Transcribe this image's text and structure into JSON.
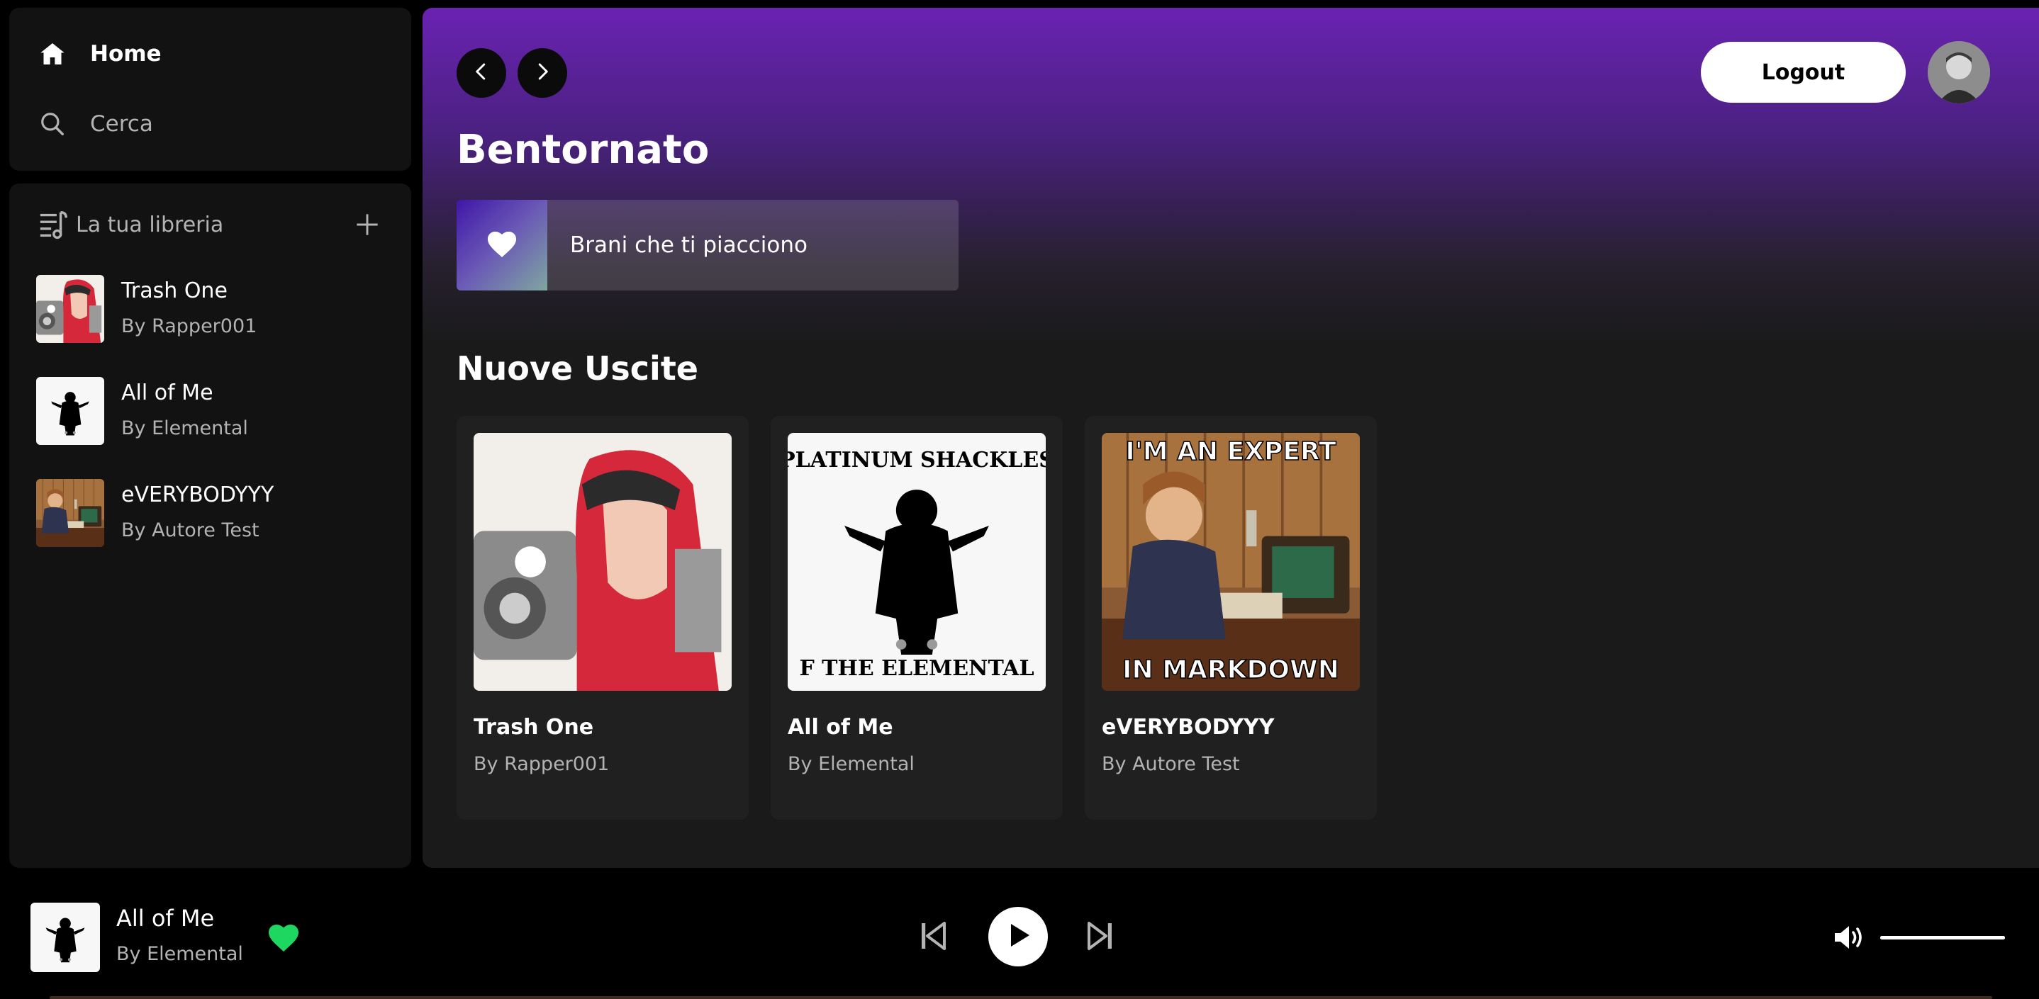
{
  "sidebar": {
    "nav": {
      "home_label": "Home",
      "search_label": "Cerca"
    },
    "library": {
      "title": "La tua libreria",
      "items": [
        {
          "title": "Trash One",
          "artist": "By Rapper001"
        },
        {
          "title": "All of Me",
          "artist": "By Elemental"
        },
        {
          "title": "eVERYBODYYY",
          "artist": "By Autore Test"
        }
      ]
    }
  },
  "header": {
    "logout_label": "Logout"
  },
  "main": {
    "greeting": "Bentornato",
    "liked_songs_label": "Brani che ti piacciono",
    "new_releases_title": "Nuove Uscite",
    "cards": [
      {
        "title": "Trash One",
        "artist": "By Rapper001"
      },
      {
        "title": "All of Me",
        "artist": "By Elemental"
      },
      {
        "title": "eVERYBODYYY",
        "artist": "By Autore Test"
      }
    ]
  },
  "artwork_text": {
    "platinum_top": "PLATINUM SHACKLES",
    "platinum_bottom": "F THE ELEMENTAL",
    "meme_top": "I'M AN EXPERT",
    "meme_bottom": "IN MARKDOWN"
  },
  "player": {
    "title": "All of Me",
    "artist": "By Elemental",
    "liked": true,
    "volume": 1.0
  },
  "colors": {
    "accent_green": "#1ed760",
    "header_purple": "#6a22b2",
    "surface": "#121212",
    "card": "#202020"
  },
  "icons": [
    "home-icon",
    "search-icon",
    "library-icon",
    "plus-icon",
    "chevron-left-icon",
    "chevron-right-icon",
    "heart-icon",
    "skip-back-icon",
    "play-icon",
    "skip-forward-icon",
    "volume-icon"
  ]
}
